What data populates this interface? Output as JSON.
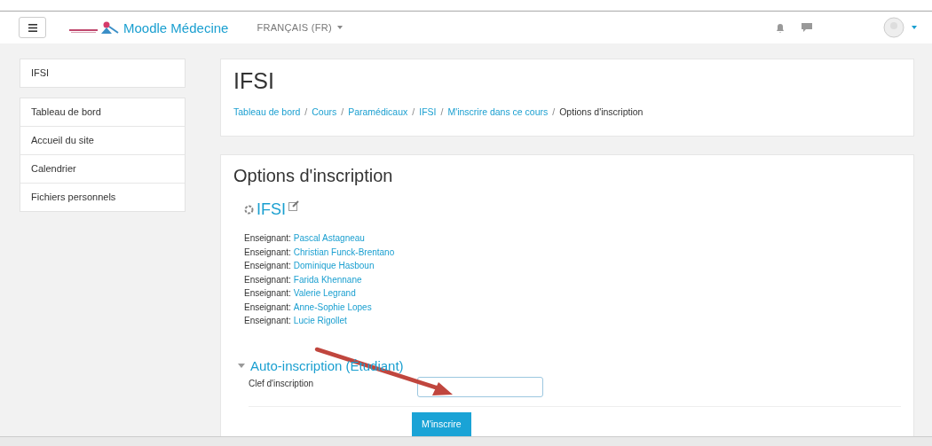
{
  "navbar": {
    "site_name": "Moodle Médecine",
    "language": "FRANÇAIS (FR)"
  },
  "sidebar": {
    "course_block": "IFSI",
    "items": [
      {
        "label": "Tableau de bord"
      },
      {
        "label": "Accueil du site"
      },
      {
        "label": "Calendrier"
      },
      {
        "label": "Fichiers personnels"
      }
    ]
  },
  "header": {
    "title": "IFSI",
    "breadcrumb": [
      {
        "kind": "link",
        "label": "Tableau de bord"
      },
      {
        "kind": "separator",
        "label": "/"
      },
      {
        "kind": "link",
        "label": "Cours"
      },
      {
        "kind": "separator",
        "label": "/"
      },
      {
        "kind": "link",
        "label": "Paramédicaux"
      },
      {
        "kind": "separator",
        "label": "/"
      },
      {
        "kind": "link",
        "label": "IFSI"
      },
      {
        "kind": "separator",
        "label": "/"
      },
      {
        "kind": "link",
        "label": "M'inscrire dans ce cours"
      },
      {
        "kind": "separator",
        "label": "/"
      },
      {
        "kind": "current",
        "label": "Options d'inscription"
      }
    ]
  },
  "content": {
    "title": "Options d'inscription",
    "course_name": "IFSI",
    "teachers": [
      {
        "role": "Enseignant:",
        "name": "Pascal Astagneau"
      },
      {
        "role": "Enseignant:",
        "name": "Christian Funck-Brentano"
      },
      {
        "role": "Enseignant:",
        "name": "Dominique Hasboun"
      },
      {
        "role": "Enseignant:",
        "name": "Farida Khennane"
      },
      {
        "role": "Enseignant:",
        "name": "Valerie Legrand"
      },
      {
        "role": "Enseignant:",
        "name": "Anne-Sophie Lopes"
      },
      {
        "role": "Enseignant:",
        "name": "Lucie Rigollet"
      }
    ],
    "section": {
      "title": "Auto-inscription (Étudiant)",
      "expanded": true,
      "field_label": "Clef d'inscription",
      "button": "M'inscrire"
    }
  }
}
